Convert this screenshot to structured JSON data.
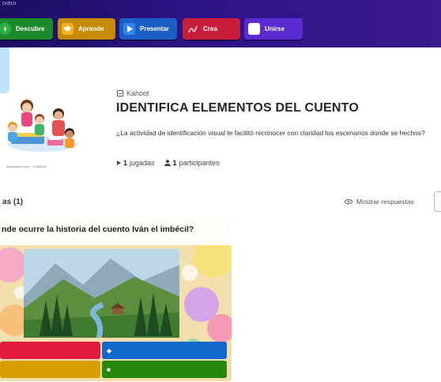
{
  "topbar": {
    "corner_text": "DUELO",
    "nav": [
      {
        "label": "Descubre",
        "icon": "compass-icon"
      },
      {
        "label": "Aprende",
        "icon": "graduation-cap-icon"
      },
      {
        "label": "Presentar",
        "icon": "play-icon"
      },
      {
        "label": "Crea",
        "icon": "pen-icon"
      },
      {
        "label": "Unirse",
        "icon": "game-pin-icon"
      }
    ],
    "colors": {
      "bar": "#2d1486",
      "descubre": "#1e8a2e",
      "aprende": "#c58a06",
      "presentar": "#1c5fc4",
      "crea": "#c91e3a",
      "unirse": "#5a2bd0"
    }
  },
  "kahoot": {
    "kind": "Kahoot",
    "title": "IDENTIFICA ELEMENTOS DEL CUENTO",
    "description": "¿La actividad de identificación visual te facilitó reconocer con claridad los escenarios donde se hechos?",
    "plays_count": "1",
    "plays_label": "jugadas",
    "participants_count": "1",
    "participants_label": "participantes",
    "cover_credit": "dreamstime.com · 22958702"
  },
  "questions": {
    "header": "as (1)",
    "show_answers": "Mostrar respuestas",
    "items": [
      {
        "text": "nde ocurre la historia del cuento Iván el imbécil?",
        "answer_colors": [
          "#e21b3c",
          "#1368ce",
          "#d89e00",
          "#26890c"
        ],
        "answer_marks": [
          "",
          "◆",
          "",
          "■"
        ]
      }
    ]
  }
}
